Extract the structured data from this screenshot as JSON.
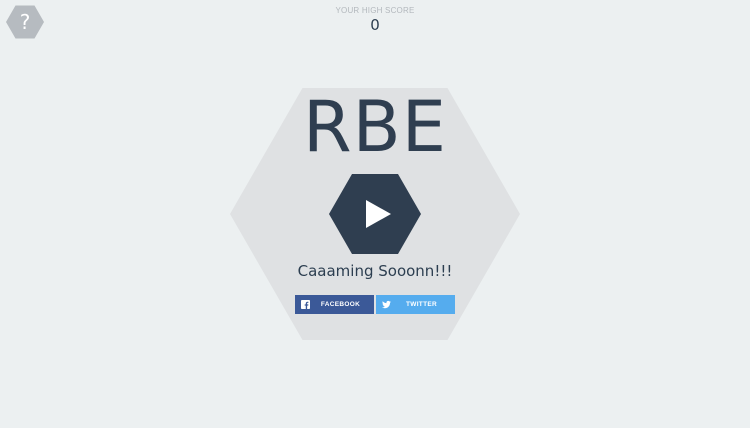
{
  "help": {
    "glyph": "?"
  },
  "score": {
    "label": "YOUR HIGH SCORE",
    "value": "0"
  },
  "title": "RBE",
  "tagline": "Caaaming Sooonn!!!",
  "share": {
    "facebook": {
      "label": "FACEBOOK",
      "icon": "facebook-icon",
      "color": "#3b5998"
    },
    "twitter": {
      "label": "TWITTER",
      "icon": "twitter-icon",
      "color": "#55acee"
    }
  },
  "colors": {
    "background": "#ecf0f1",
    "hex_panel": "#dfe1e3",
    "dark": "#2f3e50",
    "help_hex": "#b6bbc0"
  }
}
